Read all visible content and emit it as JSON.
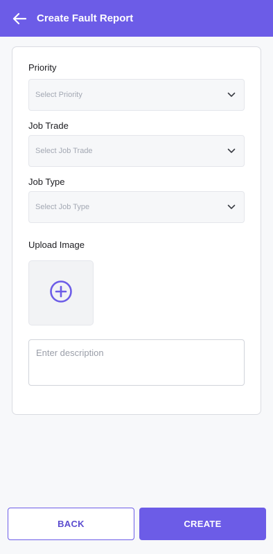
{
  "header": {
    "title": "Create Fault Report",
    "back_icon": "arrow-left-icon",
    "background_color": "#6c5ce7"
  },
  "form": {
    "priority": {
      "label": "Priority",
      "placeholder": "Select Priority"
    },
    "job_trade": {
      "label": "Job Trade",
      "placeholder": "Select Job Trade"
    },
    "job_type": {
      "label": "Job Type",
      "placeholder": "Select Job Type"
    },
    "upload": {
      "label": "Upload Image",
      "icon": "plus-circle-icon"
    },
    "description": {
      "placeholder": "Enter description"
    }
  },
  "actions": {
    "back_label": "BACK",
    "create_label": "CREATE"
  },
  "colors": {
    "accent": "#6c5ce7"
  }
}
